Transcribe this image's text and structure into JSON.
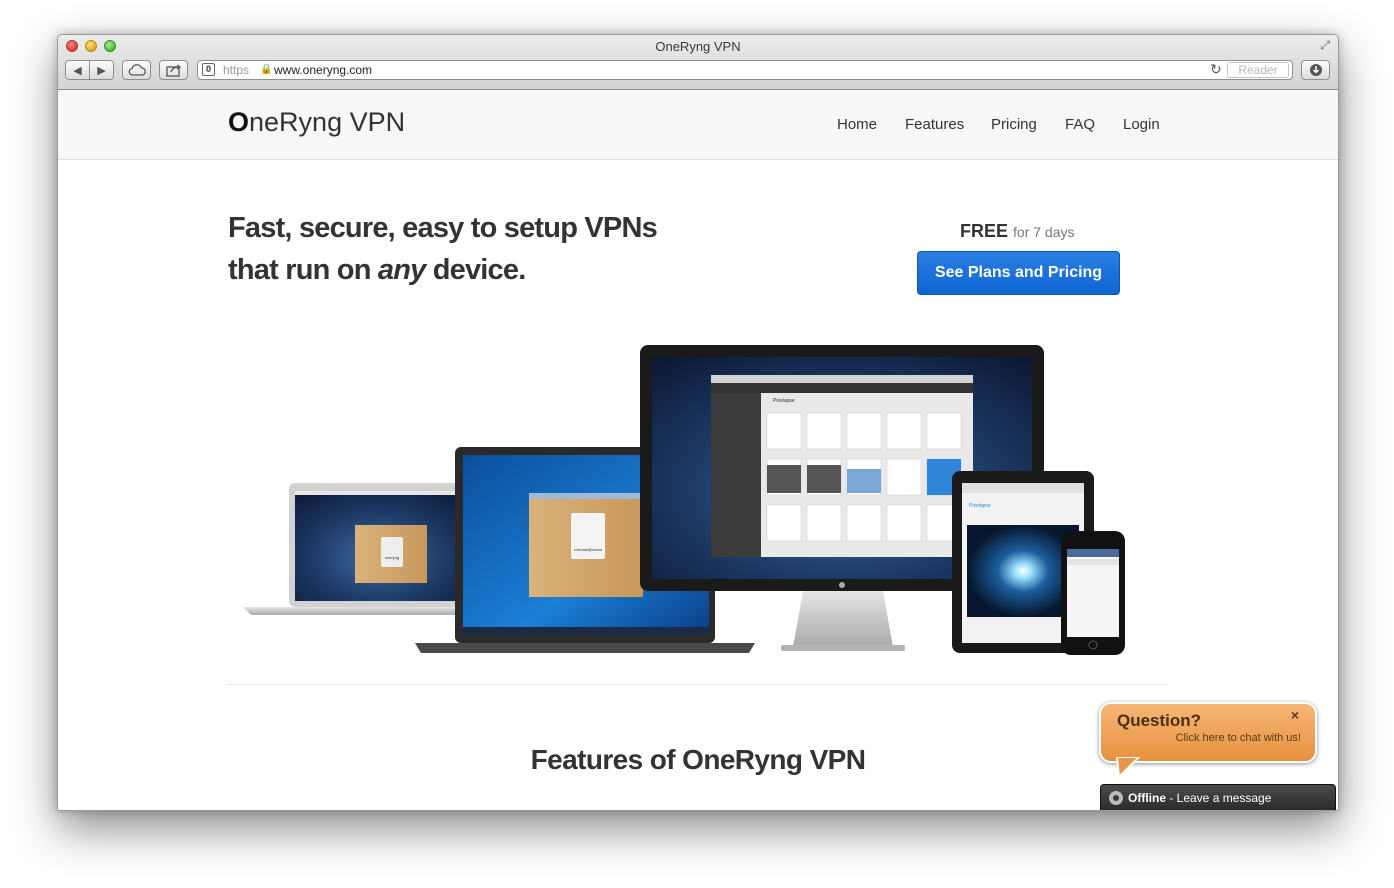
{
  "browser": {
    "window_title": "OneRyng VPN",
    "https_label": "https",
    "url": "www.oneryng.com",
    "reader_label": "Reader"
  },
  "site": {
    "brand_first_letter": "O",
    "brand_rest": "neRyng VPN",
    "nav": [
      "Home",
      "Features",
      "Pricing",
      "FAQ",
      "Login"
    ]
  },
  "hero": {
    "line1": "Fast, secure, easy to setup VPNs",
    "line2_prefix": "that run on ",
    "line2_emphasis": "any",
    "line2_suffix": " device.",
    "free_label": "FREE",
    "free_duration": "for 7 days",
    "cta_label": "See Plans and Pricing"
  },
  "devices_screens": {
    "imac_app_name": "Pixelapse",
    "laptop_label": "michael@mesa",
    "macbook_label": "oneryng",
    "ipad_app_name": "Pixelapse"
  },
  "features": {
    "heading": "Features of OneRyng VPN"
  },
  "chat": {
    "title": "Question?",
    "subtitle": "Click here to chat with us!",
    "close": "×",
    "offline_status": "Offline",
    "offline_message": " - Leave a message"
  }
}
